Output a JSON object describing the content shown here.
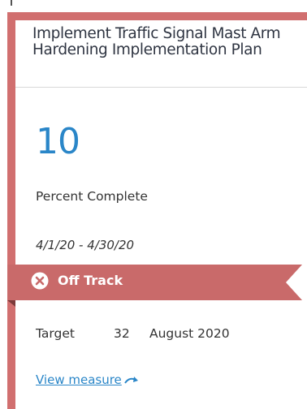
{
  "card": {
    "title": "Implement Traffic Signal Mast Arm Hardening Implementation Plan",
    "value": "10",
    "metric_label": "Percent Complete",
    "date_range": "4/1/20 - 4/30/20",
    "status": {
      "label": "Off Track",
      "icon": "x-circle-icon",
      "color": "#c96a6a"
    },
    "target": {
      "label": "Target",
      "value": "32",
      "date": "August 2020"
    },
    "link": {
      "label": "View measure",
      "icon": "arrow-right-icon"
    }
  },
  "colors": {
    "accent": "#d16f6f",
    "value": "#2a86c8",
    "link": "#2a86c8"
  }
}
